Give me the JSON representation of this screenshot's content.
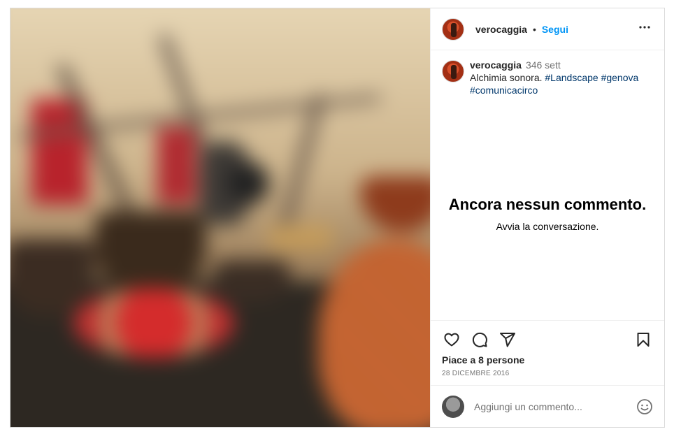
{
  "post": {
    "image_alt": "Foto sfocata di strumenti musicali",
    "username": "verocaggia",
    "separator": "•",
    "follow_label": "Segui",
    "more_label": "•••"
  },
  "caption": {
    "username": "verocaggia",
    "time": "346 sett",
    "text": "Alchimia sonora. ",
    "hashtags": [
      "#Landscape",
      "#genova",
      "#comunicacirco"
    ]
  },
  "comments": {
    "empty_title": "Ancora nessun commento.",
    "empty_subtitle": "Avvia la conversazione."
  },
  "actions": {
    "icons": [
      "heart-icon",
      "comment-icon",
      "share-icon",
      "bookmark-icon"
    ],
    "likes": "Piace a 8 persone",
    "date": "28 DICEMBRE 2016"
  },
  "composer": {
    "placeholder": "Aggiungi un commento...",
    "emoji_icon": "emoji-icon"
  }
}
